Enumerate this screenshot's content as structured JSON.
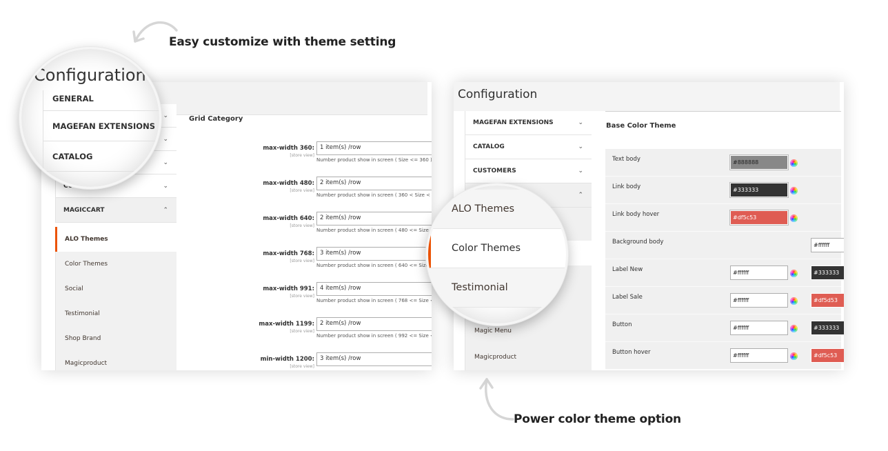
{
  "captions": {
    "top": "Easy customize with theme setting",
    "bottom": "Power color theme option"
  },
  "left_panel": {
    "nav": {
      "groups": [
        {
          "label": "GENERAL",
          "state": "collapsed"
        },
        {
          "label": "MAGEFAN EXTENSIONS",
          "state": "collapsed"
        },
        {
          "label": "CATALOG",
          "state": "collapsed"
        },
        {
          "label": "CUSTOMERS",
          "state": "collapsed"
        },
        {
          "label": "MAGICCART",
          "state": "expanded"
        }
      ],
      "items": [
        {
          "label": "ALO Themes",
          "active": true
        },
        {
          "label": "Color Themes",
          "active": false
        },
        {
          "label": "Social",
          "active": false
        },
        {
          "label": "Testimonial",
          "active": false
        },
        {
          "label": "Shop Brand",
          "active": false
        },
        {
          "label": "Magicproduct",
          "active": false
        }
      ]
    },
    "section_title": "Grid Category",
    "scope_label": "[store view]",
    "grid_rows": [
      {
        "label": "max-width 360:",
        "value": "1 item(s) /row",
        "note": "Number product show in screen ( Size <= 360 )"
      },
      {
        "label": "max-width 480:",
        "value": "2 item(s) /row",
        "note": "Number product show in screen ( 360 < Size <"
      },
      {
        "label": "max-width 640:",
        "value": "2 item(s) /row",
        "note": "Number product show in screen ( 480 <= Size <"
      },
      {
        "label": "max-width 768:",
        "value": "3 item(s) /row",
        "note": "Number product show in screen ( 640 <= Size <"
      },
      {
        "label": "max-width 991:",
        "value": "4 item(s) /row",
        "note": "Number product show in screen ( 768 <= Size <"
      },
      {
        "label": "max-width 1199:",
        "value": "2 item(s) /row",
        "note": "Number product show in screen ( 992 <= Size <"
      },
      {
        "label": "min-width 1200:",
        "value": "3 item(s) /row",
        "note": ""
      }
    ],
    "magnifier": {
      "title": "Configuration",
      "groups": [
        "GENERAL",
        "MAGEFAN EXTENSIONS",
        "CATALOG"
      ]
    }
  },
  "right_panel": {
    "title": "Configuration",
    "nav": {
      "groups": [
        {
          "label": "MAGEFAN EXTENSIONS",
          "state": "collapsed"
        },
        {
          "label": "CATALOG",
          "state": "collapsed"
        },
        {
          "label": "CUSTOMERS",
          "state": "collapsed"
        },
        {
          "label": "",
          "state": "expanded"
        }
      ],
      "items": [
        {
          "label": "Magic Menu"
        },
        {
          "label": "Magicproduct"
        }
      ]
    },
    "section_title": "Base Color Theme",
    "color_rows": [
      {
        "label": "Text body",
        "color1": "#888888",
        "bg1": "#888888",
        "fg1": "#222222",
        "color2": null
      },
      {
        "label": "Link body",
        "color1": "#333333",
        "bg1": "#333333",
        "fg1": "#ffffff",
        "color2": null
      },
      {
        "label": "Link body hover",
        "color1": "#df5c53",
        "bg1": "#df5c53",
        "fg1": "#ffffff",
        "color2": null
      },
      {
        "label": "Background body",
        "color1": null,
        "color2": "#ffffff",
        "bg2": "#ffffff",
        "fg2": "#222222",
        "single_right": true
      },
      {
        "label": "Label New",
        "color1": "#ffffff",
        "bg1": "#ffffff",
        "fg1": "#222222",
        "color2": "#333333",
        "bg2": "#333333",
        "fg2": "#ffffff"
      },
      {
        "label": "Label Sale",
        "color1": "#ffffff",
        "bg1": "#ffffff",
        "fg1": "#222222",
        "color2": "#df5d53",
        "bg2": "#df5d53",
        "fg2": "#ffffff"
      },
      {
        "label": "Button",
        "color1": "#ffffff",
        "bg1": "#ffffff",
        "fg1": "#222222",
        "color2": "#333333",
        "bg2": "#333333",
        "fg2": "#ffffff"
      },
      {
        "label": "Button hover",
        "color1": "#ffffff",
        "bg1": "#ffffff",
        "fg1": "#222222",
        "color2": "#df5c53",
        "bg2": "#df5c53",
        "fg2": "#ffffff"
      }
    ],
    "magnifier": {
      "items": [
        {
          "label": "ALO Themes",
          "active": false
        },
        {
          "label": "Color Themes",
          "active": true
        },
        {
          "label": "Testimonial",
          "active": false
        }
      ]
    }
  },
  "accent_color": "#eb5202"
}
